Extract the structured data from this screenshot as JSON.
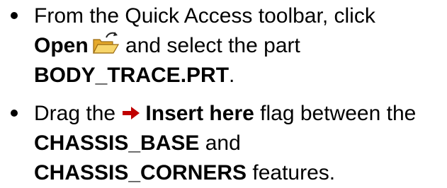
{
  "steps": [
    {
      "line1": "From the Quick Access toolbar, click",
      "open_label": "Open",
      "after_icon": " and select the part",
      "part_name": "BODY_TRACE.PRT",
      "period": ".",
      "icon": "open-folder-icon"
    },
    {
      "prefix": "Drag the ",
      "flag_label": "Insert here",
      "suffix": " flag between the",
      "feature_a": "CHASSIS_BASE",
      "and_text": " and",
      "feature_b": "CHASSIS_CORNERS",
      "tail": " features.",
      "icon": "right-arrow-icon"
    }
  ],
  "colors": {
    "text": "#000000",
    "arrow": "#c00000",
    "folder": "#f5c542"
  }
}
